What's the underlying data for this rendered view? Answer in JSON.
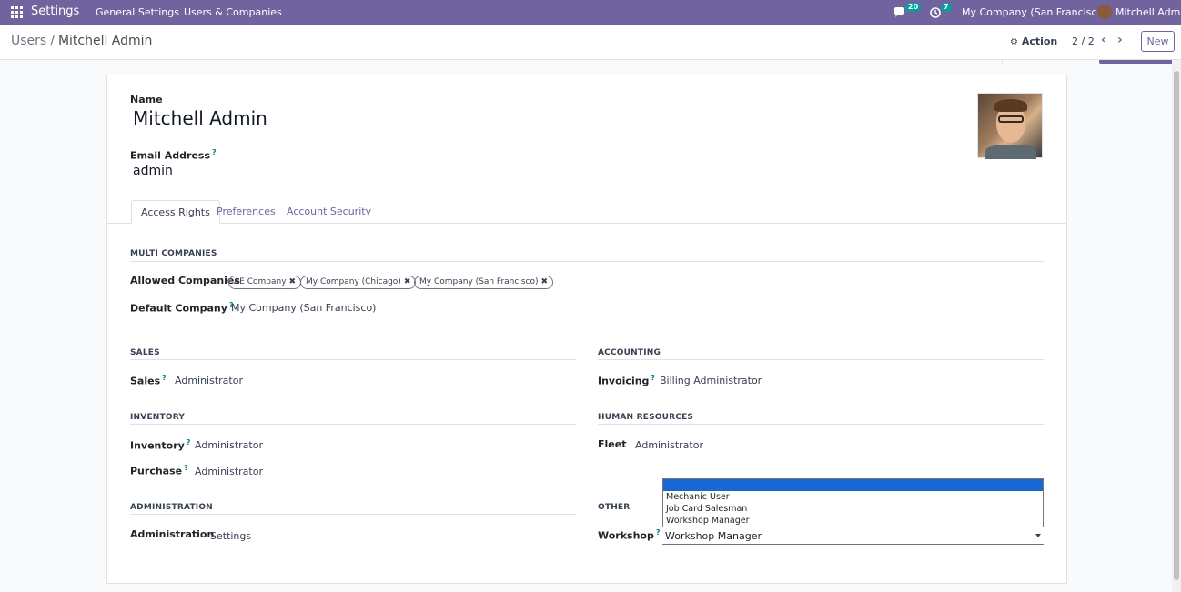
{
  "navbar": {
    "app_name": "Settings",
    "menu": [
      "General Settings",
      "Users & Companies"
    ],
    "messages_count": "20",
    "activities_count": "7",
    "company": "My Company (San Francisco)",
    "user": "Mitchell Admin"
  },
  "control_panel": {
    "breadcrumb_parent": "Users",
    "breadcrumb_current": "Mitchell Admin",
    "action_label": "Action",
    "pager": "2 / 2",
    "new_label": "New"
  },
  "form": {
    "name_label": "Name",
    "name": "Mitchell Admin",
    "email_label": "Email Address",
    "email": "admin",
    "tabs": [
      "Access Rights",
      "Preferences",
      "Account Security"
    ],
    "multi_companies": {
      "title": "MULTI COMPANIES",
      "allowed_label": "Allowed Companies",
      "allowed": [
        "AE Company",
        "My Company (Chicago)",
        "My Company (San Francisco)"
      ],
      "default_label": "Default Company",
      "default": "My Company (San Francisco)"
    },
    "sales": {
      "title": "SALES",
      "label": "Sales",
      "value": "Administrator"
    },
    "accounting": {
      "title": "ACCOUNTING",
      "label": "Invoicing",
      "value": "Billing Administrator"
    },
    "inventory": {
      "title": "INVENTORY",
      "inventory_label": "Inventory",
      "inventory_value": "Administrator",
      "purchase_label": "Purchase",
      "purchase_value": "Administrator"
    },
    "human_resources": {
      "title": "HUMAN RESOURCES",
      "label": "Fleet",
      "value": "Administrator"
    },
    "administration": {
      "title": "ADMINISTRATION",
      "label": "Administration",
      "value": "Settings"
    },
    "other": {
      "title": "OTHER",
      "label": "Workshop",
      "value": "Workshop Manager",
      "options": [
        "",
        "Mechanic User",
        "Job Card Salesman",
        "Workshop Manager"
      ]
    },
    "tooltip_mark": "?"
  },
  "colors": {
    "brand": "#71639e",
    "highlight": "#1967d2",
    "badge": "#00a09d"
  }
}
